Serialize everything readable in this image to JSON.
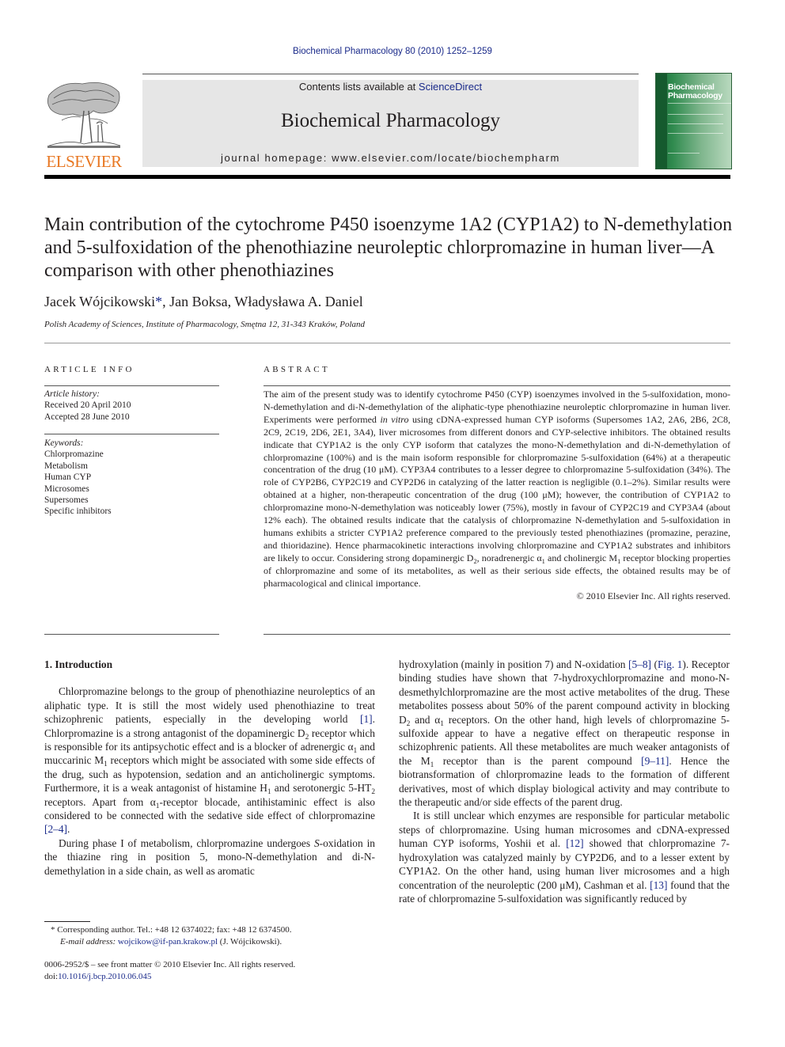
{
  "journal_citation": "Biochemical Pharmacology 80 (2010) 1252–1259",
  "header": {
    "publisher_logo_text": "ELSEVIER",
    "contents_prefix": "Contents lists available at ",
    "contents_link": "ScienceDirect",
    "journal_name": "Biochemical Pharmacology",
    "homepage": "journal homepage: www.elsevier.com/locate/biochempharm",
    "cover_title_line1": "Biochemical",
    "cover_title_line2": "Pharmacology"
  },
  "colors": {
    "link": "#1a2a8a",
    "elsevier_orange": "#e87722",
    "banner_gray": "#e6e6e6",
    "cover_green": "#2f8a4e"
  },
  "article": {
    "title": "Main contribution of the cytochrome P450 isoenzyme 1A2 (CYP1A2) to N-demethylation and 5-sulfoxidation of the phenothiazine neuroleptic chlorpromazine in human liver—A comparison with other phenothiazines",
    "authors": [
      {
        "name": "Jacek Wójcikowski",
        "mark": "*",
        "sep": ", "
      },
      {
        "name": "Jan Boksa",
        "mark": "",
        "sep": ", "
      },
      {
        "name": "Władysława A. Daniel",
        "mark": "",
        "sep": ""
      }
    ],
    "affiliation": "Polish Academy of Sciences, Institute of Pharmacology, Smętna 12, 31-343 Kraków, Poland"
  },
  "article_info": {
    "heading": "ARTICLE INFO",
    "history_label": "Article history:",
    "received": "Received 20 April 2010",
    "accepted": "Accepted 28 June 2010",
    "keywords_label": "Keywords:",
    "keywords": [
      "Chlorpromazine",
      "Metabolism",
      "Human CYP",
      "Microsomes",
      "Supersomes",
      "Specific inhibitors"
    ]
  },
  "abstract": {
    "heading": "ABSTRACT",
    "p1": "The aim of the present study was to identify cytochrome P450 (CYP) isoenzymes involved in the 5-sulfoxidation, mono-N-demethylation and di-N-demethylation of the aliphatic-type phenothiazine neuroleptic chlorpromazine in human liver. Experiments were performed ",
    "p1_italic": "in vitro",
    "p2": " using cDNA-expressed human CYP isoforms (Supersomes 1A2, 2A6, 2B6, 2C8, 2C9, 2C19, 2D6, 2E1, 3A4), liver microsomes from different donors and CYP-selective inhibitors. The obtained results indicate that CYP1A2 is the only CYP isoform that catalyzes the mono-N-demethylation and di-N-demethylation of chlorpromazine (100%) and is the main isoform responsible for chlorpromazine 5-sulfoxidation (64%) at a therapeutic concentration of the drug (10 μM). CYP3A4 contributes to a lesser degree to chlorpromazine 5-sulfoxidation (34%). The role of CYP2B6, CYP2C19 and CYP2D6 in catalyzing of the latter reaction is negligible (0.1–2%). Similar results were obtained at a higher, non-therapeutic concentration of the drug (100 μM); however, the contribution of CYP1A2 to chlorpromazine mono-N-demethylation was noticeably lower (75%), mostly in favour of CYP2C19 and CYP3A4 (about 12% each). The obtained results indicate that the catalysis of chlorpromazine N-demethylation and 5-sulfoxidation in humans exhibits a stricter CYP1A2 preference compared to the previously tested phenothiazines (promazine, perazine, and thioridazine). Hence pharmacokinetic interactions involving chlorpromazine and CYP1A2 substrates and inhibitors are likely to occur. Considering strong dopaminergic D",
    "p3": ", noradrenergic α",
    "p4": " and cholinergic M",
    "p5": " receptor blocking properties of chlorpromazine and some of its metabolites, as well as their serious side effects, the obtained results may be of pharmacological and clinical importance.",
    "sub2": "2",
    "sub1": "1",
    "copyright": "© 2010 Elsevier Inc. All rights reserved."
  },
  "intro": {
    "heading": "1.  Introduction",
    "left": {
      "a1": "Chlorpromazine belongs to the group of phenothiazine neuroleptics of an aliphatic type. It is still the most widely used phenothiazine to treat schizophrenic patients, especially in the developing world ",
      "ref1": "[1]",
      "a2": ". Chlorpromazine is a strong antagonist of the dopaminergic D",
      "a3": " receptor which is responsible for its antipsychotic effect and is a blocker of adrenergic α",
      "a4": " and muccarinic M",
      "a5": " receptors which might be associated with some side effects of the drug, such as hypotension, sedation and an anticholinergic symptoms. Furthermore, it is a weak antagonist of histamine H",
      "a6": " and serotonergic 5-HT",
      "a7": " receptors. Apart from α",
      "a8": "-receptor blocade, antihistaminic effect is also considered to be connected with the sedative side effect of chlorpromazine ",
      "ref2": "[2–4]",
      "a9": ".",
      "b1_italic": "S",
      "b0": "During phase I of metabolism, chlorpromazine undergoes ",
      "b2": "-oxidation in the thiazine ring in position 5, mono-N-demethylation and di-N-demethylation in a side chain, as well as aromatic"
    },
    "right": {
      "c1": "hydroxylation (mainly in position 7) and N-oxidation ",
      "ref5": "[5–8]",
      "c2": " (",
      "fig": "Fig. 1",
      "c3": "). Receptor binding studies have shown that 7-hydroxychlorpromazine and mono-N-desmethylchlorpromazine are the most active metabolites of the drug. These metabolites possess about 50% of the parent compound activity in blocking D",
      "c4": " and α",
      "c5": " receptors. On the other hand, high levels of chlorpromazine 5-sulfoxide appear to have a negative effect on therapeutic response in schizophrenic patients. All these metabolites are much weaker antagonists of the M",
      "c6": " receptor than is the parent compound ",
      "ref9": "[9–11]",
      "c7": ". Hence the biotransformation of chlorpromazine leads to the formation of different derivatives, most of which display biological activity and may contribute to the therapeutic and/or side effects of the parent drug.",
      "d1": "It is still unclear which enzymes are responsible for particular metabolic steps of chlorpromazine. Using human microsomes and cDNA-expressed human CYP isoforms, Yoshii et al. ",
      "ref12": "[12]",
      "d2": " showed that chlorpromazine 7-hydroxylation was catalyzed mainly by CYP2D6, and to a lesser extent by CYP1A2. On the other hand, using human liver microsomes and a high concentration of the neuroleptic (200 μM), Cashman et al. ",
      "ref13": "[13]",
      "d3": " found that the rate of chlorpromazine 5-sulfoxidation was significantly reduced by"
    }
  },
  "footnote": {
    "mark": "*",
    "text": " Corresponding author. Tel.: +48 12 6374022; fax: +48 12 6374500.",
    "email_label": "E-mail address: ",
    "email": "wojcikow@if-pan.krakow.pl",
    "email_suffix": " (J. Wójcikowski)."
  },
  "front_matter": {
    "issn_line": "0006-2952/$ – see front matter © 2010 Elsevier Inc. All rights reserved.",
    "doi_prefix": "doi:",
    "doi": "10.1016/j.bcp.2010.06.045"
  }
}
